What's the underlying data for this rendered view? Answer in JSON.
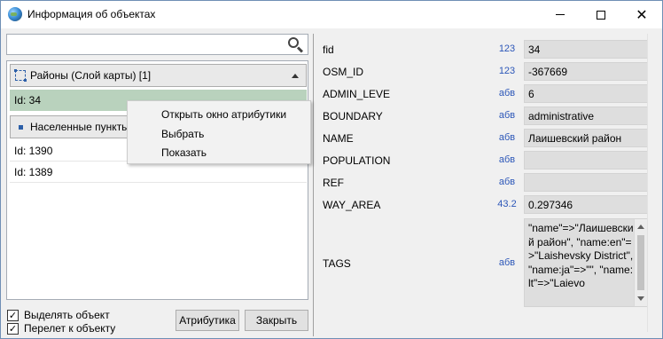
{
  "window": {
    "title": "Информация об объектах",
    "close_glyph": "✕"
  },
  "search": {
    "value": "",
    "placeholder": ""
  },
  "tree": {
    "groups": [
      {
        "label": "Районы (Слой карты) [1]",
        "icon": "layer-icon",
        "rows": [
          {
            "label": "Id: 34",
            "selected": true
          }
        ]
      },
      {
        "label": "Населенные пункты",
        "icon": "point-layer-icon",
        "rows": [
          {
            "label": "Id: 1390"
          },
          {
            "label": "Id: 1389"
          }
        ]
      }
    ]
  },
  "context_menu": {
    "items": [
      {
        "label": "Открыть окно атрибутики"
      },
      {
        "label": "Выбрать"
      },
      {
        "label": "Показать"
      }
    ]
  },
  "options": {
    "highlight_object": {
      "label": "Выделять объект",
      "checked": true
    },
    "fly_to_object": {
      "label": "Перелет к объекту",
      "checked": true
    },
    "check_glyph": "✓"
  },
  "buttons": {
    "attributes": "Атрибутика",
    "close": "Закрыть"
  },
  "properties": [
    {
      "name": "fid",
      "type": "123",
      "value": "34"
    },
    {
      "name": "OSM_ID",
      "type": "123",
      "value": "-367669"
    },
    {
      "name": "ADMIN_LEVE",
      "type": "абв",
      "value": "6"
    },
    {
      "name": "BOUNDARY",
      "type": "абв",
      "value": "administrative"
    },
    {
      "name": "NAME",
      "type": "абв",
      "value": "Лаишевский район"
    },
    {
      "name": "POPULATION",
      "type": "абв",
      "value": ""
    },
    {
      "name": "REF",
      "type": "абв",
      "value": ""
    },
    {
      "name": "WAY_AREA",
      "type": "43.2",
      "value": "0.297346"
    }
  ],
  "tags": {
    "name": "TAGS",
    "type": "абв",
    "value": "\"name\"=>\"Лаишевский район\", \"name:en\"=>\"Laishevsky District\", \"name:ja\"=>\"\", \"name:lt\"=>\"Laievo"
  },
  "colors": {
    "selected_row": "#b9d2bd",
    "type_label": "#2b56b8"
  }
}
